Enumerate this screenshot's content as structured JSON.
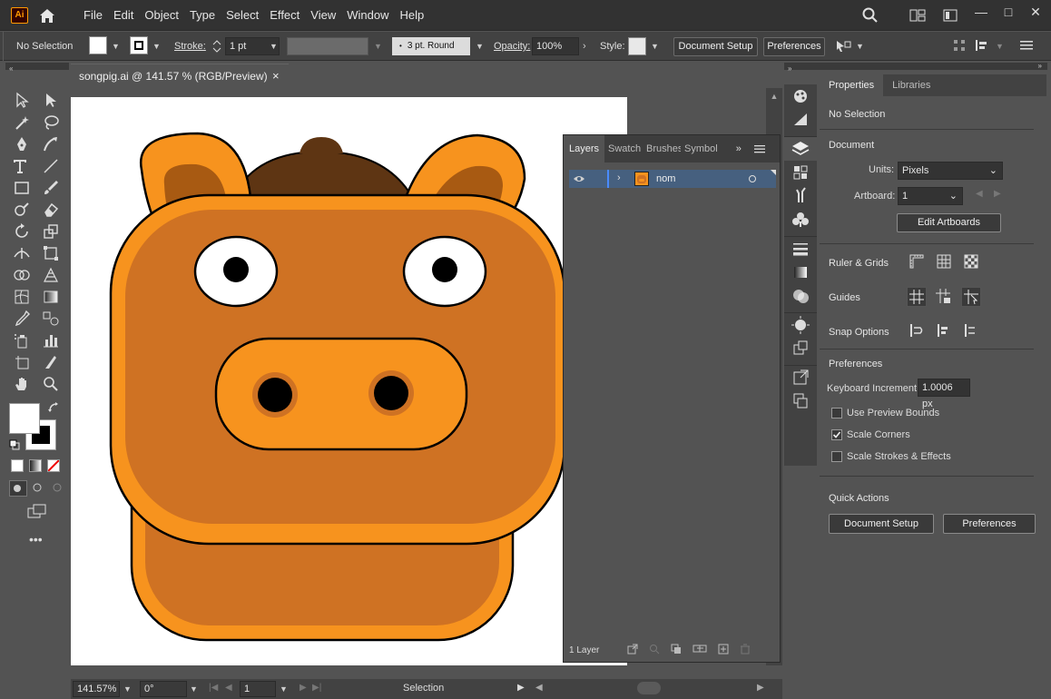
{
  "app": {
    "logo": "Ai"
  },
  "menu": [
    "File",
    "Edit",
    "Object",
    "Type",
    "Select",
    "Effect",
    "View",
    "Window",
    "Help"
  ],
  "window_controls": {
    "minimize": "—",
    "maximize": "□",
    "close": "✕"
  },
  "controlbar": {
    "selection": "No Selection",
    "stroke_label": "Stroke:",
    "stroke_value": "1 pt",
    "brush_value": "3 pt. Round",
    "opacity_label": "Opacity:",
    "opacity_value": "100%",
    "style_label": "Style:",
    "document_setup": "Document Setup",
    "preferences": "Preferences"
  },
  "document": {
    "tab_title": "songpig.ai @ 141.57 % (RGB/Preview)",
    "close": "×"
  },
  "layers_panel": {
    "tabs": [
      "Layers",
      "Swatch",
      "Brushes",
      "Symbol"
    ],
    "layer_name": "nom",
    "footer_count": "1 Layer"
  },
  "properties": {
    "tabs": [
      "Properties",
      "Libraries"
    ],
    "selection": "No Selection",
    "document_title": "Document",
    "units_label": "Units:",
    "units_value": "Pixels",
    "artboard_label": "Artboard:",
    "artboard_value": "1",
    "edit_artboards": "Edit Artboards",
    "ruler_grids": "Ruler & Grids",
    "guides": "Guides",
    "snap_options": "Snap Options",
    "preferences_title": "Preferences",
    "keyboard_increment_label": "Keyboard Increment:",
    "keyboard_increment_value": "1.0006 px",
    "use_preview_bounds": "Use Preview Bounds",
    "use_preview_bounds_checked": false,
    "scale_corners": "Scale Corners",
    "scale_corners_checked": true,
    "scale_strokes": "Scale Strokes & Effects",
    "scale_strokes_checked": false,
    "quick_actions": "Quick Actions",
    "qa_document_setup": "Document Setup",
    "qa_preferences": "Preferences"
  },
  "statusbar": {
    "zoom": "141.57%",
    "rotation": "0°",
    "artboard": "1",
    "tool": "Selection"
  },
  "colors": {
    "pig_orange": "#f7931e",
    "pig_dark": "#cf7223",
    "ear_inner": "#a85a12",
    "hair": "#5e3513"
  }
}
